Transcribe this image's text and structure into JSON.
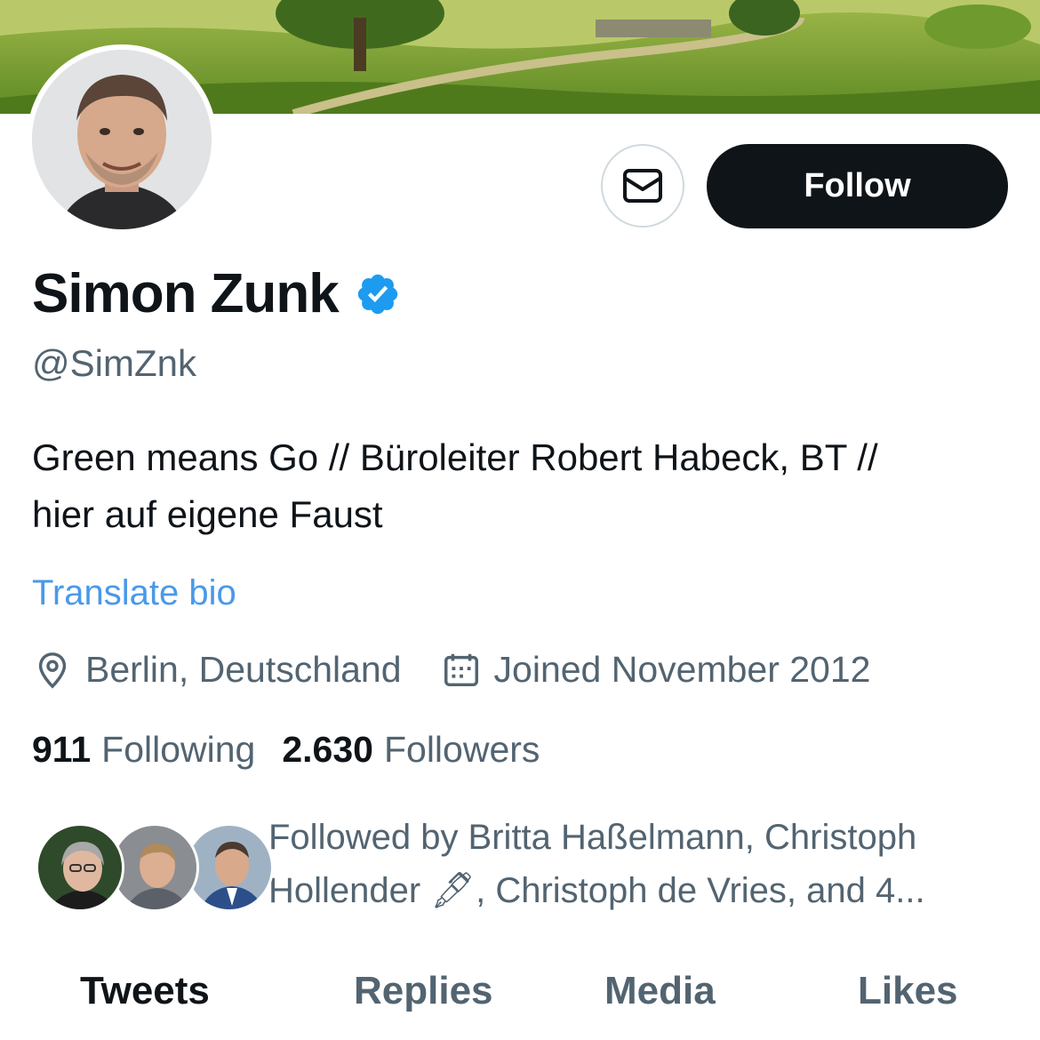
{
  "profile": {
    "display_name": "Simon Zunk",
    "handle": "@SimZnk",
    "bio_line1": "Green means Go // Büroleiter Robert Habeck, BT //",
    "bio_line2": "hier auf eigene Faust",
    "translate_label": "Translate bio",
    "location": "Berlin, Deutschland",
    "joined": "Joined November 2012"
  },
  "actions": {
    "follow_label": "Follow"
  },
  "stats": {
    "following_count": "911",
    "following_label": "Following",
    "followers_count": "2.630",
    "followers_label": "Followers"
  },
  "followed_by": {
    "line1": "Followed by Britta Haßelmann, Christoph",
    "line2": "Hollender 🖋, Christoph de Vries, and 4..."
  },
  "tabs": [
    {
      "label": "Tweets",
      "active": true
    },
    {
      "label": "Replies",
      "active": false
    },
    {
      "label": "Media",
      "active": false
    },
    {
      "label": "Likes",
      "active": false
    }
  ],
  "colors": {
    "accent_blue": "#4a99e9",
    "text_primary": "#0f1419",
    "text_secondary": "#536471",
    "verified_blue": "#1d9bf0"
  },
  "icons": {
    "dm": "envelope-icon",
    "verified": "verified-badge-icon",
    "location": "location-pin-icon",
    "joined": "calendar-icon"
  }
}
